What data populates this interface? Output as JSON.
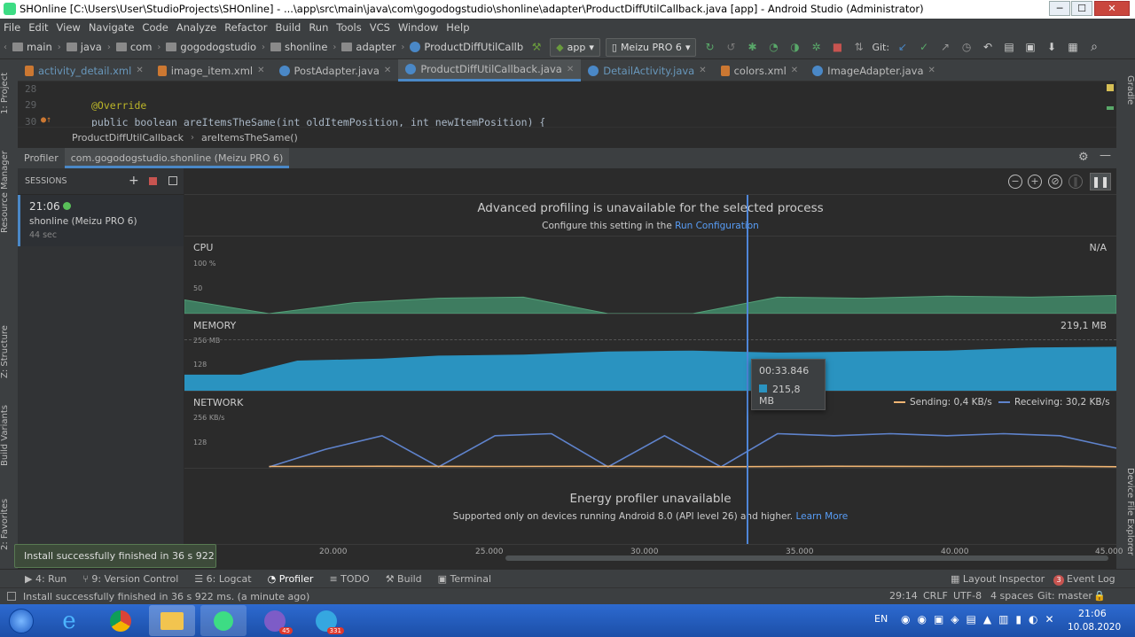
{
  "window": {
    "title": "SHOnline [C:\\Users\\User\\StudioProjects\\SHOnline] - ...\\app\\src\\main\\java\\com\\gogodogstudio\\shonline\\adapter\\ProductDiffUtilCallback.java [app] - Android Studio (Administrator)",
    "min": "─",
    "max": "☐",
    "close": "✕"
  },
  "menu": [
    "File",
    "Edit",
    "View",
    "Navigate",
    "Code",
    "Analyze",
    "Refactor",
    "Build",
    "Run",
    "Tools",
    "VCS",
    "Window",
    "Help"
  ],
  "nav": {
    "crumbs": [
      "main",
      "java",
      "com",
      "gogodogstudio",
      "shonline",
      "adapter",
      "ProductDiffUtilCallb"
    ],
    "run_config": "app",
    "device": "Meizu PRO 6",
    "git": "Git:"
  },
  "left_tools": [
    "1: Project",
    "Resource Manager",
    "Z: Structure",
    "Build Variants",
    "2: Favorites"
  ],
  "right_tools": [
    "Gradle",
    "Device File Explorer"
  ],
  "tabs": [
    {
      "label": "activity_detail.xml",
      "type": "xml"
    },
    {
      "label": "image_item.xml",
      "type": "xml"
    },
    {
      "label": "PostAdapter.java",
      "type": "java"
    },
    {
      "label": "ProductDiffUtilCallback.java",
      "type": "java",
      "active": true
    },
    {
      "label": "DetailActivity.java",
      "type": "java"
    },
    {
      "label": "colors.xml",
      "type": "xml"
    },
    {
      "label": "ImageAdapter.java",
      "type": "java"
    }
  ],
  "editor": {
    "lines": [
      {
        "num": "28",
        "text": ""
      },
      {
        "num": "29",
        "text": "@Override"
      },
      {
        "num": "30",
        "text": "public boolean areItemsTheSame(int oldItemPosition, int newItemPosition) {"
      }
    ]
  },
  "breadcrumb": [
    "ProductDiffUtilCallback",
    "areItemsTheSame()"
  ],
  "profiler": {
    "tabs": [
      "Profiler",
      "com.gogodogstudio.shonline (Meizu PRO 6)"
    ],
    "sessions_label": "SESSIONS",
    "session": {
      "time": "21:06",
      "name": "shonline (Meizu PRO 6)",
      "duration": "44 sec"
    },
    "banner": {
      "title": "Advanced profiling is unavailable for the selected process",
      "text": "Configure this setting in the ",
      "link": "Run Configuration"
    },
    "cpu": {
      "label": "CPU",
      "value": "N/A",
      "ticks": [
        "100 %",
        "50"
      ]
    },
    "memory": {
      "label": "MEMORY",
      "value": "219,1 MB",
      "ticks": [
        "256 MB",
        "128"
      ]
    },
    "network": {
      "label": "NETWORK",
      "ticks": [
        "256 KB/s",
        "128"
      ],
      "sending": "Sending: 0,4 KB/s",
      "receiving": "Receiving: 30,2 KB/s"
    },
    "energy": {
      "title": "Energy profiler unavailable",
      "text": "Supported only on devices running Android 8.0 (API level 26) and higher. ",
      "link": "Learn More"
    },
    "tooltip": {
      "time": "00:33.846",
      "value": "215,8 MB"
    },
    "axis": [
      "20.000",
      "25.000",
      "30.000",
      "35.000",
      "40.000",
      "45.000"
    ]
  },
  "chart_data": [
    {
      "type": "area",
      "title": "CPU",
      "ylabel": "",
      "ylim": [
        0,
        100
      ],
      "x": [
        13,
        16,
        19,
        22,
        25,
        28,
        31,
        34,
        37,
        40,
        43,
        46
      ],
      "values": [
        25,
        0,
        20,
        28,
        30,
        0,
        0,
        30,
        28,
        32,
        30,
        33
      ]
    },
    {
      "type": "area",
      "title": "MEMORY",
      "ylabel": "",
      "ylim": [
        0,
        256
      ],
      "x": [
        13,
        15,
        17,
        20,
        22,
        25,
        28,
        31,
        34,
        37,
        40,
        43,
        46
      ],
      "values": [
        80,
        80,
        150,
        160,
        175,
        180,
        195,
        200,
        190,
        195,
        200,
        215,
        219
      ]
    },
    {
      "type": "line",
      "title": "NETWORK",
      "ylabel": "",
      "ylim": [
        0,
        256
      ],
      "series": [
        {
          "name": "Receiving",
          "x": [
            16,
            18,
            20,
            22,
            24,
            26,
            28,
            30,
            32,
            34,
            36,
            38,
            40,
            42,
            44,
            46
          ],
          "values": [
            0,
            85,
            150,
            0,
            150,
            160,
            0,
            150,
            0,
            160,
            150,
            160,
            150,
            160,
            150,
            90
          ]
        },
        {
          "name": "Sending",
          "x": [
            16,
            20,
            24,
            28,
            32,
            36,
            40,
            44,
            46
          ],
          "values": [
            2,
            3,
            2,
            3,
            1,
            3,
            2,
            3,
            1
          ]
        }
      ]
    }
  ],
  "bottom_tools": [
    "4: Run",
    "9: Version Control",
    "6: Logcat",
    "Profiler",
    "TODO",
    "Build",
    "Terminal"
  ],
  "bottom_right": [
    "Layout Inspector",
    "Event Log"
  ],
  "event_badge": "3",
  "toast": "Install successfully finished in 36 s 922 ms.",
  "status": {
    "text": "Install successfully finished in 36 s 922 ms. (a minute ago)",
    "pos": "29:14",
    "crlf": "CRLF",
    "enc": "UTF-8",
    "indent": "4 spaces",
    "git": "Git: master"
  },
  "taskbar": {
    "lang": "EN",
    "time": "21:06",
    "date": "10.08.2020",
    "badges": [
      "45",
      "331"
    ]
  }
}
